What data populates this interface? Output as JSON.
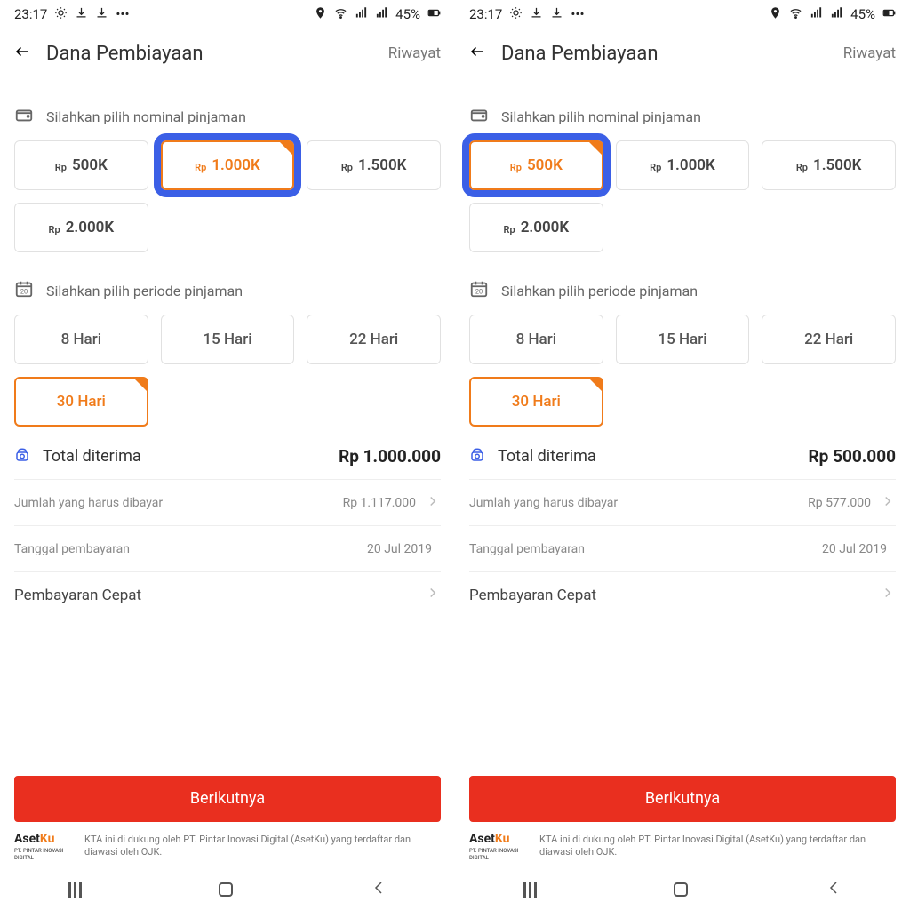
{
  "screens": [
    {
      "status": {
        "time": "23:17",
        "battery": "45%"
      },
      "header": {
        "title": "Dana Pembiayaan",
        "action": "Riwayat"
      },
      "nominal": {
        "label": "Silahkan pilih nominal pinjaman",
        "options": [
          "500K",
          "1.000K",
          "1.500K",
          "2.000K"
        ],
        "selected_index": 1,
        "highlight_index": 1,
        "currency": "Rp"
      },
      "period": {
        "label": "Silahkan pilih periode pinjaman",
        "options": [
          "8 Hari",
          "15 Hari",
          "22 Hari",
          "30 Hari"
        ],
        "selected_index": 3
      },
      "total": {
        "label": "Total diterima",
        "value": "Rp 1.000.000"
      },
      "rows": {
        "pay_label": "Jumlah yang harus dibayar",
        "pay_value": "Rp 1.117.000",
        "date_label": "Tanggal pembayaran",
        "date_value": "20 Jul 2019",
        "fast_label": "Pembayaran Cepat"
      },
      "cta": "Berikutnya",
      "disclaimer": {
        "brand_a": "Aset",
        "brand_b": "Ku",
        "brand_sub": "PT. PINTAR INOVASI DIGITAL",
        "text": "KTA ini di dukung oleh PT. Pintar Inovasi Digital (AsetKu) yang terdaftar dan diawasi oleh OJK."
      }
    },
    {
      "status": {
        "time": "23:17",
        "battery": "45%"
      },
      "header": {
        "title": "Dana Pembiayaan",
        "action": "Riwayat"
      },
      "nominal": {
        "label": "Silahkan pilih nominal pinjaman",
        "options": [
          "500K",
          "1.000K",
          "1.500K",
          "2.000K"
        ],
        "selected_index": 0,
        "highlight_index": 0,
        "currency": "Rp"
      },
      "period": {
        "label": "Silahkan pilih periode pinjaman",
        "options": [
          "8 Hari",
          "15 Hari",
          "22 Hari",
          "30 Hari"
        ],
        "selected_index": 3
      },
      "total": {
        "label": "Total diterima",
        "value": "Rp 500.000"
      },
      "rows": {
        "pay_label": "Jumlah yang harus dibayar",
        "pay_value": "Rp 577.000",
        "date_label": "Tanggal pembayaran",
        "date_value": "20 Jul 2019",
        "fast_label": "Pembayaran Cepat"
      },
      "cta": "Berikutnya",
      "disclaimer": {
        "brand_a": "Aset",
        "brand_b": "Ku",
        "brand_sub": "PT. PINTAR INOVASI DIGITAL",
        "text": "KTA ini di dukung oleh PT. Pintar Inovasi Digital (AsetKu) yang terdaftar dan diawasi oleh OJK."
      }
    }
  ]
}
